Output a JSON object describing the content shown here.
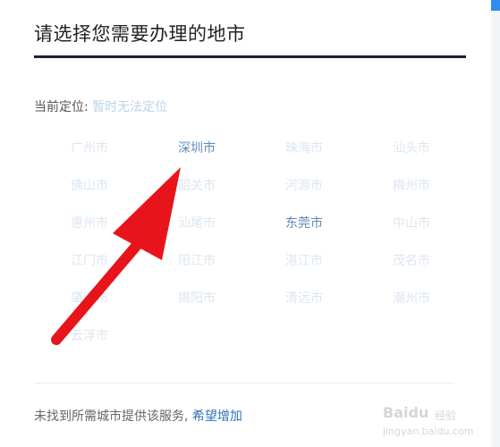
{
  "dialog": {
    "title": "请选择您需要办理的地市",
    "location_label": "当前定位:",
    "location_value": "暂时无法定位"
  },
  "cities": [
    {
      "name": "广州市",
      "active": false
    },
    {
      "name": "深圳市",
      "active": true
    },
    {
      "name": "珠海市",
      "active": false
    },
    {
      "name": "汕头市",
      "active": false
    },
    {
      "name": "佛山市",
      "active": false
    },
    {
      "name": "韶关市",
      "active": false
    },
    {
      "name": "河源市",
      "active": false
    },
    {
      "name": "梅州市",
      "active": false
    },
    {
      "name": "惠州市",
      "active": false
    },
    {
      "name": "汕尾市",
      "active": false
    },
    {
      "name": "东莞市",
      "active": true
    },
    {
      "name": "中山市",
      "active": false
    },
    {
      "name": "江门市",
      "active": false
    },
    {
      "name": "阳江市",
      "active": false
    },
    {
      "name": "湛江市",
      "active": false
    },
    {
      "name": "茂名市",
      "active": false
    },
    {
      "name": "肇庆市",
      "active": false
    },
    {
      "name": "揭阳市",
      "active": false
    },
    {
      "name": "清远市",
      "active": false
    },
    {
      "name": "潮州市",
      "active": false
    },
    {
      "name": "云浮市",
      "active": false
    }
  ],
  "footer": {
    "text": "未找到所需城市提供该服务,",
    "link": "希望增加"
  },
  "watermark": {
    "brand": "Baidu",
    "sub": "经验",
    "url": "jingyan.baidu.com"
  },
  "colors": {
    "arrow": "#e8141b",
    "link": "#2e6fb7",
    "active_city": "#5c8ab8",
    "inactive_city": "#dbe6f1"
  }
}
